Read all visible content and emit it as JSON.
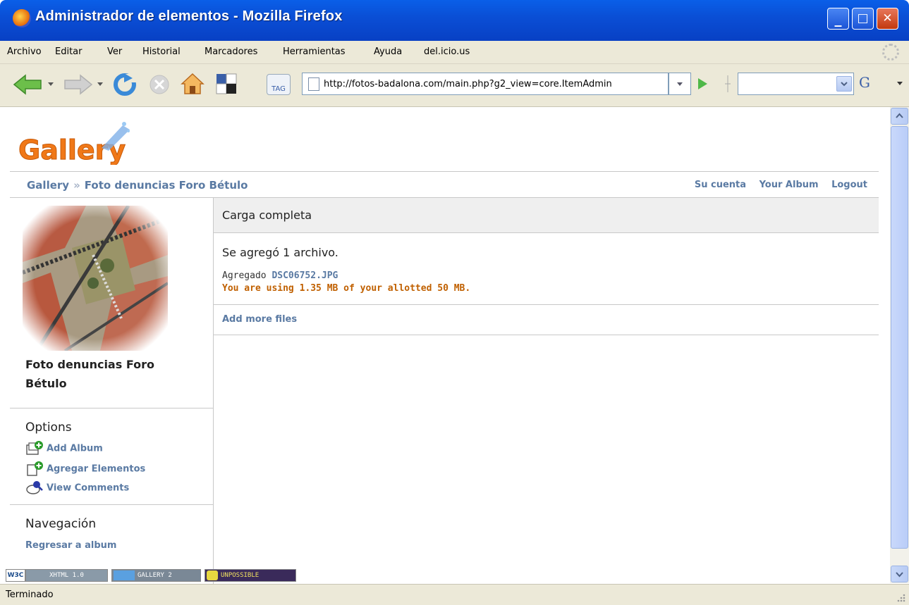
{
  "window": {
    "title": "Administrador de elementos - Mozilla Firefox",
    "minimize_glyph": "_",
    "maximize_glyph": "□",
    "close_glyph": "✕"
  },
  "menu": [
    "Archivo",
    "Editar",
    "Ver",
    "Historial",
    "Marcadores",
    "Herramientas",
    "Ayuda",
    "del.icio.us"
  ],
  "toolbar": {
    "url": "http://fotos-badalona.com/main.php?g2_view=core.ItemAdmin",
    "search_value": "",
    "tag_label": "TAG",
    "search_engine_glyph": "G"
  },
  "page": {
    "logo_text": "Gallery",
    "breadcrumb": {
      "root": "Gallery",
      "separator": "»",
      "current": "Foto denuncias Foro Bétulo"
    },
    "top_links": [
      "Su cuenta",
      "Your Album",
      "Logout"
    ],
    "sidebar": {
      "album_title": "Foto denuncias Foro Bétulo",
      "options_heading": "Options",
      "options": [
        "Add Album",
        "Agregar Elementos",
        "View Comments"
      ],
      "nav_heading": "Navegación",
      "nav_link": "Regresar a album"
    },
    "main": {
      "heading": "Carga completa",
      "result": "Se agregó 1 archivo.",
      "added_prefix": "Agregado",
      "added_file": "DSC06752.JPG",
      "quota": "You are using 1.35 MB of your allotted 50 MB.",
      "add_more": "Add more files"
    },
    "badges": [
      "W3C",
      "XHTML 1.0",
      "GALLERY 2",
      "UNPOSSIBLE"
    ]
  },
  "statusbar": {
    "text": "Terminado"
  },
  "colors": {
    "titlebar": "#0a4fd6",
    "link": "#5a7aa3",
    "quota": "#c06000",
    "chrome": "#ece9d8"
  }
}
